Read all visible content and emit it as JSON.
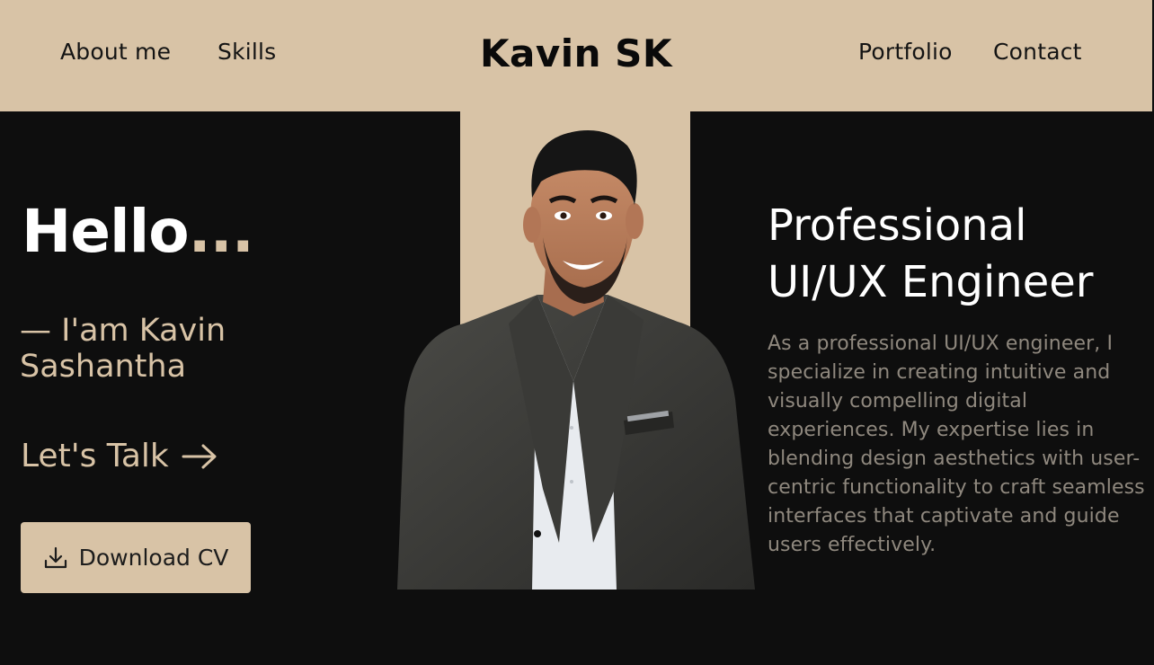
{
  "header": {
    "brand": "Kavin SK",
    "nav_left": [
      "About me",
      "Skills"
    ],
    "nav_right": [
      "Portfolio",
      "Contact"
    ],
    "background_color": "#d8c3a6"
  },
  "hero": {
    "greeting": "Hello",
    "greeting_suffix": "...",
    "intro": "— I'am Kavin Sashantha",
    "cta_label": "Let's Talk",
    "cta_icon": "arrow-right-icon",
    "download_label": "Download CV",
    "download_icon": "download-icon",
    "photo": "portrait-photo"
  },
  "about": {
    "title_line1": "Professional",
    "title_line2": "UI/UX Engineer",
    "bio": "As a professional UI/UX engineer, I specialize in creating intuitive and visually compelling digital experiences. My expertise lies in blending design aesthetics with user-centric functionality to craft seamless interfaces that captivate and guide users effectively."
  },
  "colors": {
    "accent": "#d8c3a6",
    "background": "#0e0e0e",
    "heading": "#ffffff",
    "muted_text": "#8f887e"
  }
}
